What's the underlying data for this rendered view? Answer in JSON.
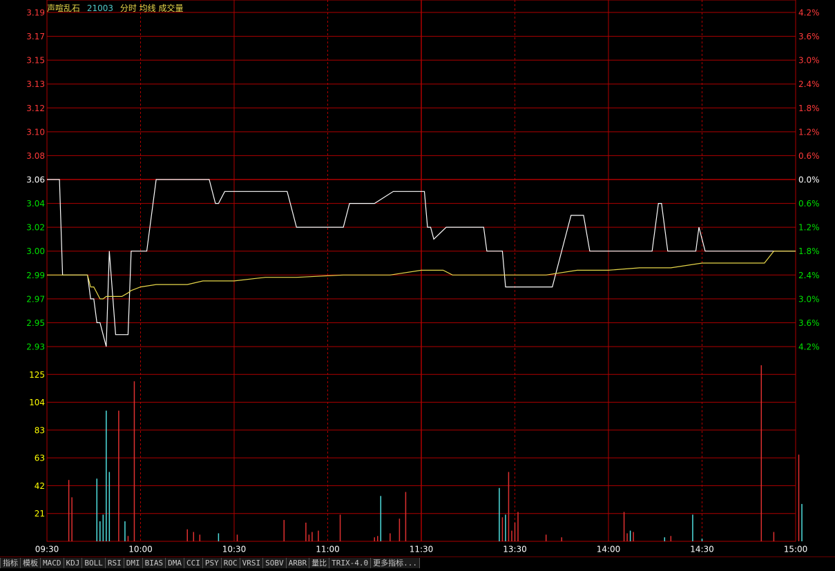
{
  "header": {
    "stock_name": "声喧乱石",
    "code": "21003",
    "chart_title": "分时 均线 成交量"
  },
  "colors": {
    "background": "#000000",
    "grid": "#b00000",
    "price_line": "#ffffff",
    "avg_line": "#e8d84a",
    "up": "#ff3a3a",
    "down": "#00e000",
    "flat": "#ffffff",
    "volume_label": "#ffff00",
    "volume_up_bar": "#e03030",
    "volume_down_bar": "#50e0e0",
    "time_label": "#ffffff"
  },
  "tabs": [
    "指标",
    "模板",
    "MACD",
    "KDJ",
    "BOLL",
    "RSI",
    "DMI",
    "BIAS",
    "DMA",
    "CCI",
    "PSY",
    "ROC",
    "VRSI",
    "SOBV",
    "ARBR",
    "量比",
    "TRIX-4.0",
    "更多指标..."
  ],
  "chart_data": {
    "type": "line",
    "time_labels": [
      "09:30",
      "10:00",
      "10:30",
      "11:00",
      "11:30",
      "13:30",
      "14:00",
      "14:30",
      "15:00"
    ],
    "price_axis": {
      "labels": [
        "3.19",
        "3.17",
        "3.15",
        "3.13",
        "3.12",
        "3.10",
        "3.08",
        "3.06",
        "3.04",
        "3.02",
        "3.00",
        "2.99",
        "2.97",
        "2.95",
        "2.93"
      ],
      "values": [
        3.19,
        3.17,
        3.15,
        3.13,
        3.12,
        3.1,
        3.08,
        3.06,
        3.04,
        3.02,
        3.0,
        2.99,
        2.97,
        2.95,
        2.93
      ],
      "reference": 3.06
    },
    "percent_axis": {
      "labels": [
        "4.2%",
        "3.6%",
        "3.0%",
        "2.4%",
        "1.8%",
        "1.2%",
        "0.6%",
        "0.0%",
        "0.6%",
        "1.2%",
        "1.8%",
        "2.4%",
        "3.0%",
        "3.6%",
        "4.2%"
      ]
    },
    "volume_axis": {
      "labels": [
        "125",
        "104",
        "83",
        "63",
        "42",
        "21"
      ],
      "values": [
        125,
        104,
        83,
        63,
        42,
        21
      ],
      "max": 146
    },
    "series": [
      {
        "name": "分时",
        "x": [
          0,
          4,
          5,
          13,
          14,
          15,
          16,
          17,
          18,
          19,
          20,
          22,
          23,
          24,
          26,
          27,
          28,
          32,
          35,
          43,
          52,
          54,
          55,
          57,
          62,
          63,
          66,
          67,
          70,
          71,
          77,
          80,
          95,
          97,
          100,
          101,
          105,
          111,
          121,
          122,
          123,
          124,
          128,
          129,
          140,
          141,
          146,
          147,
          160,
          162,
          163,
          168,
          172,
          174,
          177,
          183,
          193,
          194,
          196,
          197,
          199,
          204,
          205,
          207,
          208,
          209,
          211,
          223,
          225,
          226,
          230,
          233,
          235,
          236,
          237,
          238,
          240
        ],
        "y": [
          3.06,
          3.06,
          2.99,
          2.99,
          2.97,
          2.97,
          2.95,
          2.95,
          2.94,
          2.93,
          3.0,
          2.94,
          2.94,
          2.94,
          2.94,
          3.0,
          3.0,
          3.0,
          3.06,
          3.06,
          3.06,
          3.04,
          3.04,
          3.05,
          3.05,
          3.05,
          3.05,
          3.05,
          3.05,
          3.05,
          3.05,
          3.02,
          3.02,
          3.04,
          3.04,
          3.04,
          3.04,
          3.05,
          3.05,
          3.02,
          3.02,
          3.01,
          3.02,
          3.02,
          3.02,
          3.0,
          3.0,
          2.98,
          2.98,
          2.98,
          2.99,
          3.03,
          3.03,
          3.0,
          3.0,
          3.0,
          3.0,
          3.0,
          3.04,
          3.04,
          3.0,
          3.0,
          3.0,
          3.0,
          3.0,
          3.02,
          3.0,
          3.0,
          3.0,
          3.0,
          3.0,
          3.0,
          3.0,
          3.0,
          3.0,
          3.0,
          3.0
        ]
      },
      {
        "name": "均线",
        "x": [
          0,
          13,
          14,
          15,
          16,
          17,
          18,
          19,
          20,
          22,
          24,
          26,
          27,
          30,
          35,
          45,
          50,
          60,
          70,
          80,
          95,
          105,
          110,
          120,
          127,
          130,
          135,
          150,
          160,
          170,
          180,
          190,
          200,
          210,
          220,
          230,
          233,
          240
        ],
        "y": [
          2.99,
          2.99,
          2.98,
          2.98,
          2.975,
          2.97,
          2.97,
          2.972,
          2.972,
          2.972,
          2.972,
          2.975,
          2.977,
          2.98,
          2.982,
          2.982,
          2.985,
          2.985,
          2.988,
          2.988,
          2.99,
          2.99,
          2.99,
          2.992,
          2.992,
          2.99,
          2.99,
          2.99,
          2.99,
          2.992,
          2.992,
          2.993,
          2.993,
          2.995,
          2.995,
          2.995,
          3.0,
          3.0
        ]
      }
    ],
    "volume": {
      "x": [
        7,
        8,
        16,
        17,
        18,
        19,
        20,
        23,
        25,
        26,
        28,
        45,
        47,
        49,
        55,
        61,
        76,
        83,
        84,
        85,
        87,
        94,
        105,
        106,
        107,
        110,
        113,
        115,
        145,
        146,
        147,
        148,
        149,
        150,
        151,
        160,
        165,
        185,
        186,
        187,
        188,
        198,
        200,
        207,
        210,
        229,
        233,
        241,
        242
      ],
      "values": [
        46,
        33,
        47,
        15,
        20,
        98,
        52,
        98,
        15,
        4,
        120,
        9,
        7,
        5,
        6,
        5,
        16,
        14,
        5,
        7,
        8,
        20,
        3,
        4,
        34,
        6,
        17,
        37,
        40,
        18,
        20,
        52,
        8,
        14,
        22,
        5,
        3,
        22,
        6,
        8,
        7,
        3,
        4,
        20,
        2,
        132,
        7,
        65,
        28,
        8,
        22
      ],
      "direction": [
        "up",
        "up",
        "down",
        "down",
        "down",
        "down",
        "down",
        "up",
        "down",
        "up",
        "up",
        "up",
        "up",
        "up",
        "down",
        "up",
        "up",
        "up",
        "up",
        "up",
        "up",
        "up",
        "up",
        "up",
        "down",
        "up",
        "up",
        "up",
        "down",
        "up",
        "down",
        "up",
        "up",
        "up",
        "up",
        "up",
        "up",
        "up",
        "up",
        "down",
        "up",
        "down",
        "up",
        "down",
        "down",
        "up",
        "up",
        "up",
        "down"
      ]
    }
  }
}
